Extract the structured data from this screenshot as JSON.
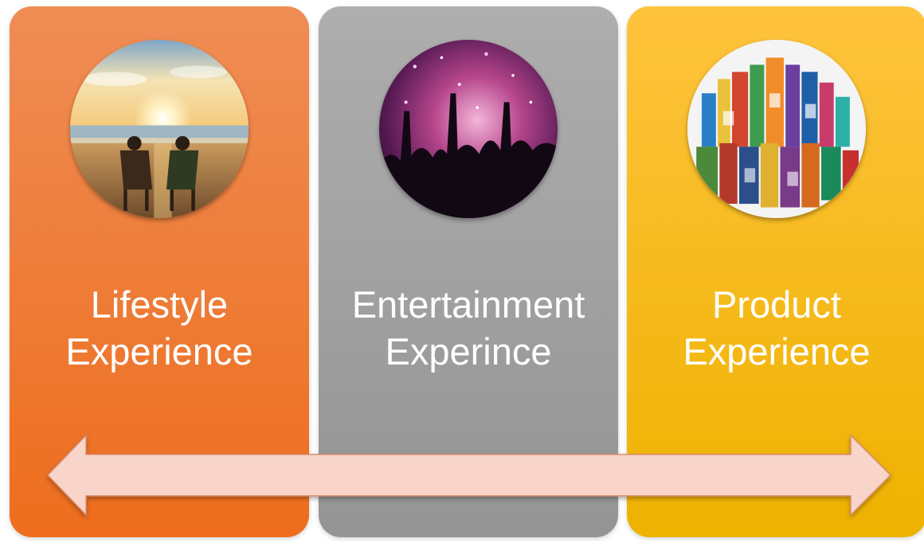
{
  "panels": [
    {
      "line1": "Lifestyle",
      "line2": "Experience",
      "color_top": "#ef8d55",
      "color_bottom": "#ee6d1d",
      "photo": "beach-sunset-couple-photo"
    },
    {
      "line1": "Entertainment",
      "line2": "Experince",
      "color_top": "#aeaeae",
      "color_bottom": "#949494",
      "photo": "concert-crowd-photo"
    },
    {
      "line1": "Product",
      "line2": "Experience",
      "color_top": "#fec33c",
      "color_bottom": "#eeb200",
      "photo": "product-collection-photo"
    }
  ],
  "arrow": {
    "type": "double-headed",
    "fill": "#f8d5c8",
    "stroke": "#d98b70"
  }
}
